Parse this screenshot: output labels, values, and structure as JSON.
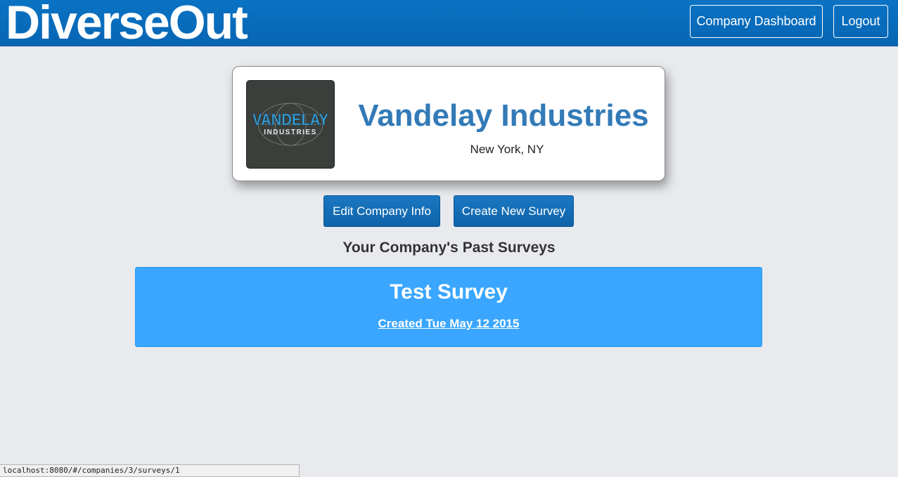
{
  "header": {
    "brand": "DiverseOut",
    "dashboard_label": "Company Dashboard",
    "logout_label": "Logout"
  },
  "company": {
    "logo_text_main": "VANDELAY",
    "logo_text_sub": "INDUSTRIES",
    "name": "Vandelay Industries",
    "location": "New York, NY"
  },
  "actions": {
    "edit_label": "Edit Company Info",
    "create_label": "Create New Survey"
  },
  "surveys": {
    "heading": "Your Company's Past Surveys",
    "items": [
      {
        "title": "Test Survey",
        "created": "Created Tue May 12 2015"
      }
    ]
  },
  "status_bar": {
    "url": "localhost:8080/#/companies/3/surveys/1"
  },
  "colors": {
    "navbar": "#0765b3",
    "accent": "#337ab7",
    "survey_card": "#3aa6ff",
    "background": "#e8eaee"
  }
}
